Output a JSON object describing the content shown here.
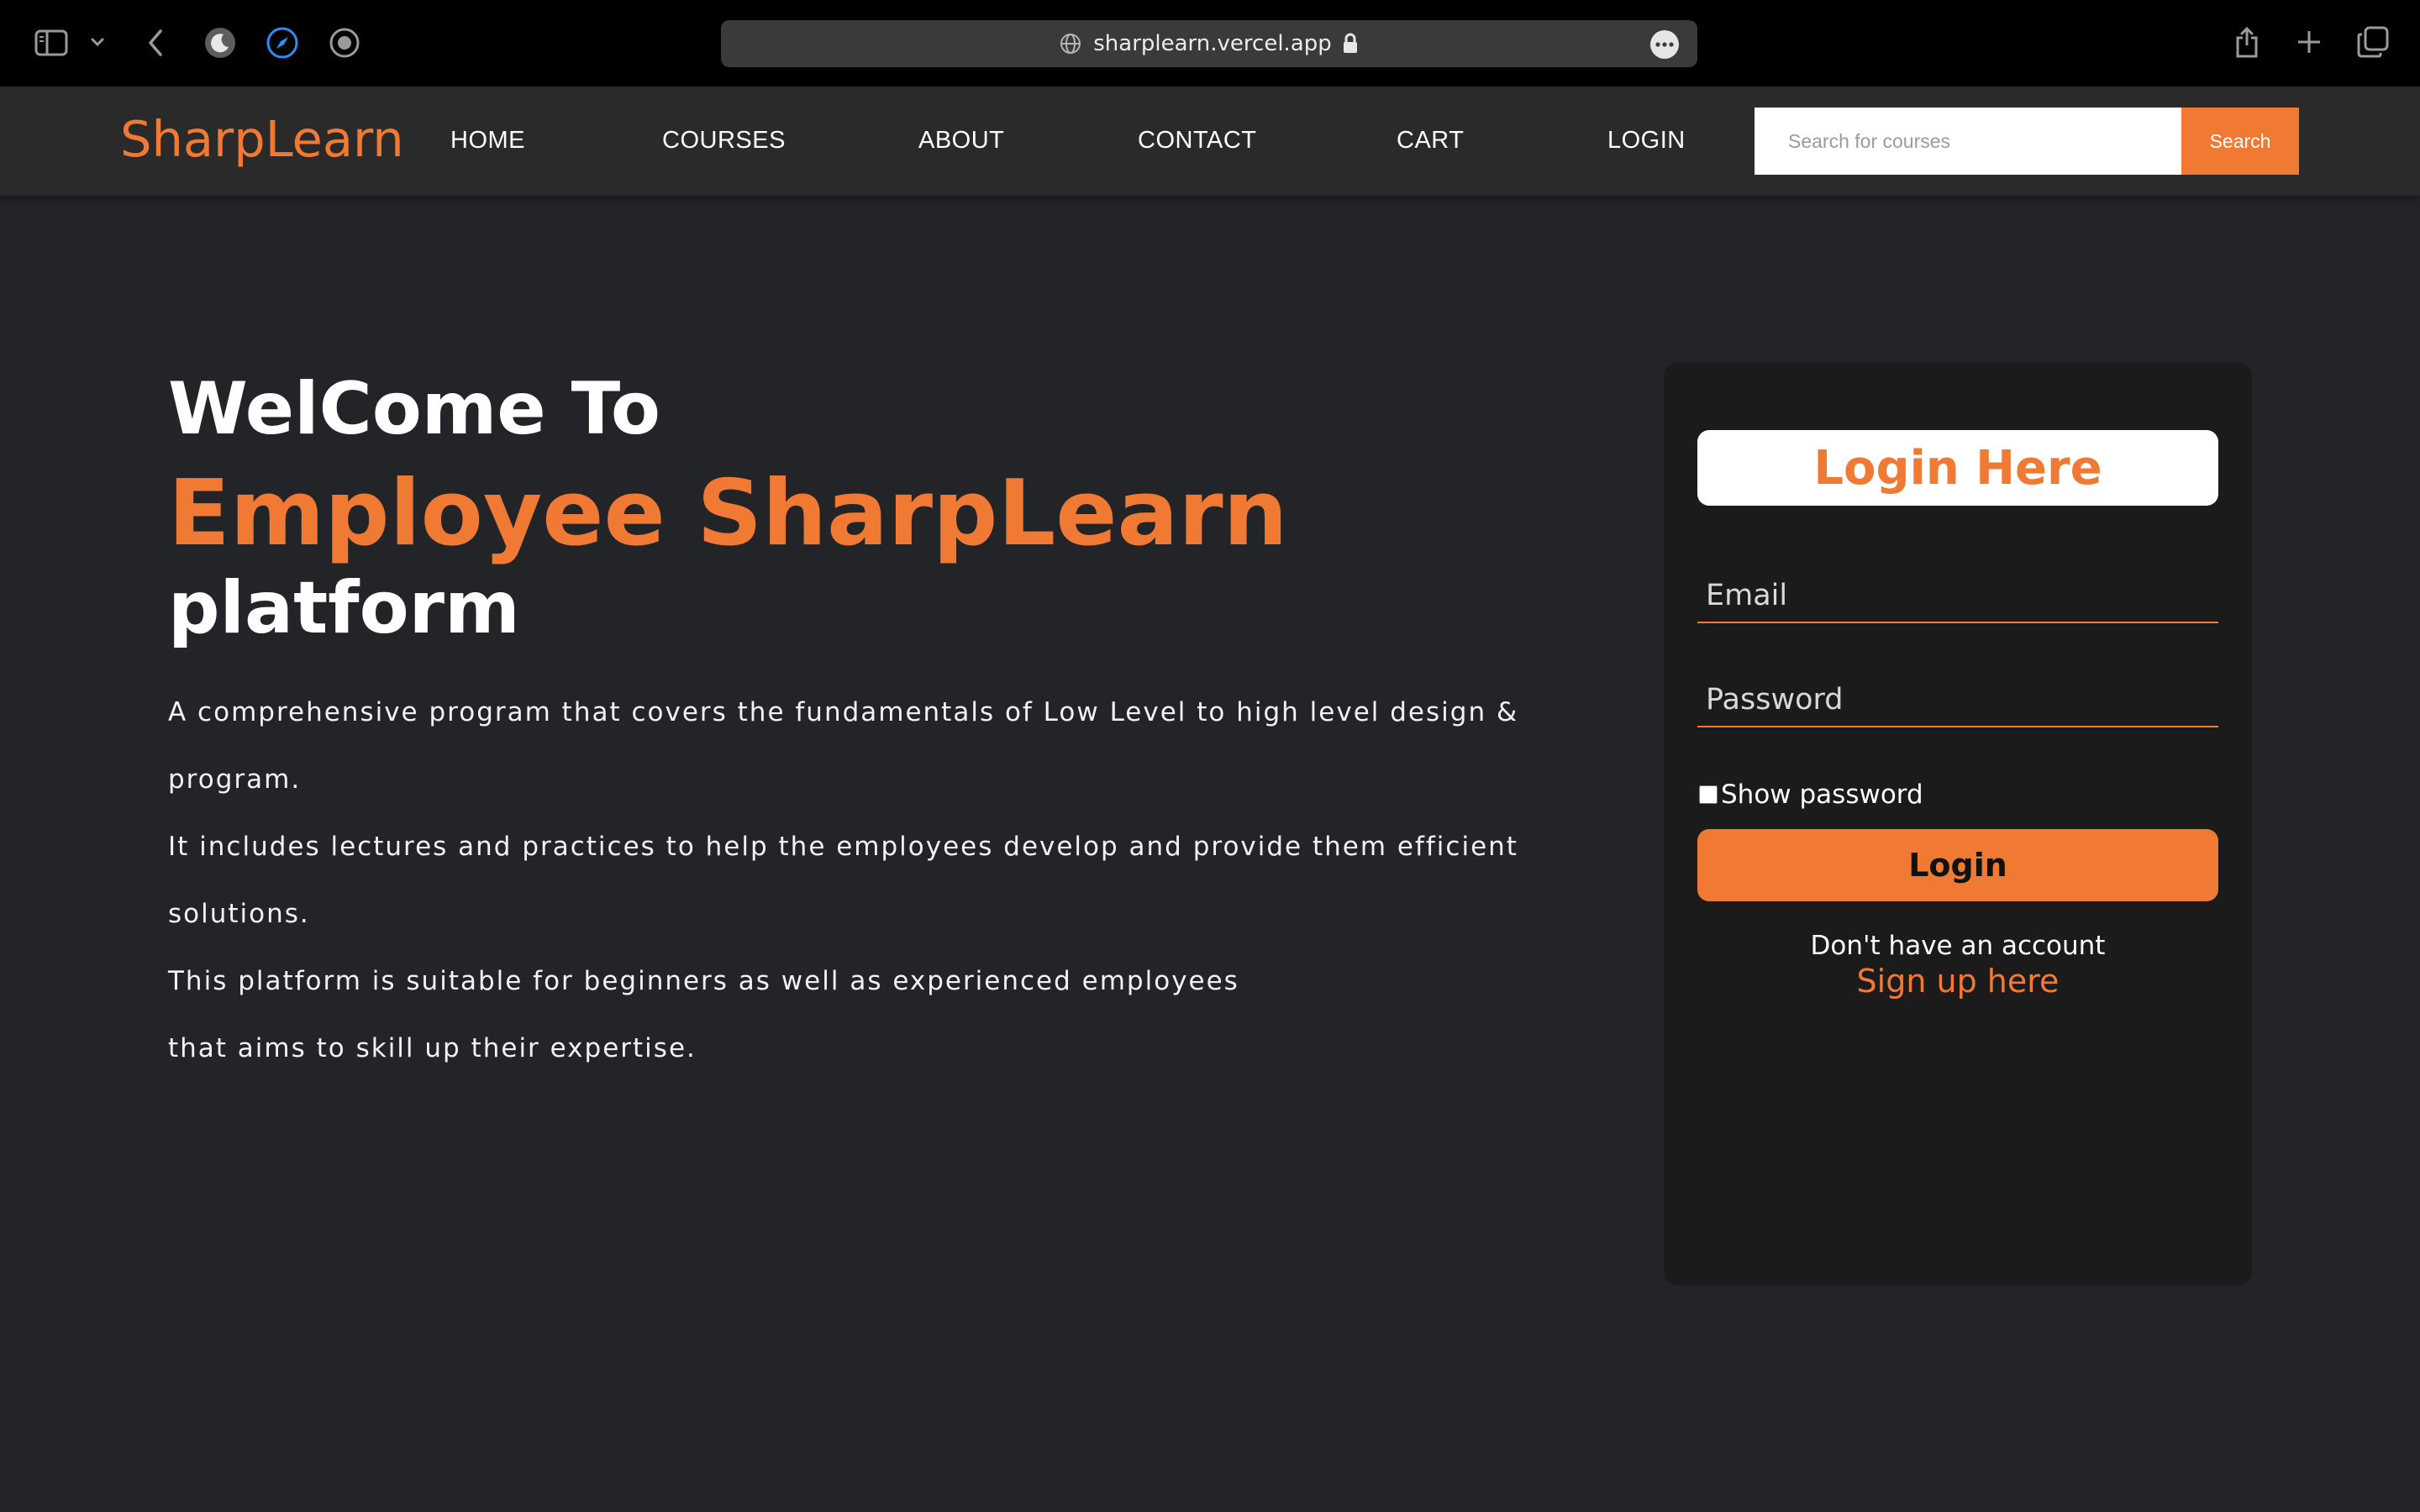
{
  "browser": {
    "url": "sharplearn.vercel.app",
    "icons": {
      "sidebar": "sidebar-icon",
      "dropdown": "chevron-down-icon",
      "back": "back-arrow-icon",
      "night_mode": "moon-icon",
      "compass": "compass-icon",
      "record": "record-icon",
      "site_globe": "globe-icon",
      "lock": "lock-icon",
      "more": "more-icon",
      "share": "share-icon",
      "new_tab": "plus-icon",
      "tabs_overview": "tabs-icon"
    }
  },
  "nav": {
    "brand": "SharpLearn",
    "links": [
      "HOME",
      "COURSES",
      "ABOUT",
      "CONTACT",
      "CART",
      "LOGIN"
    ],
    "search_placeholder": "Search for courses",
    "search_button": "Search"
  },
  "hero": {
    "line1": "WelCome To",
    "line2": "Employee SharpLearn",
    "line3": "platform",
    "paragraphs": [
      "A comprehensive program that covers the fundamentals of Low Level to high level design & program.",
      "It includes lectures and practices to help the employees develop and provide them efficient solutions.",
      "This platform is suitable for beginners as well as experienced employees",
      "that aims to skill up their expertise."
    ]
  },
  "login": {
    "title": "Login Here",
    "email_placeholder": "Email",
    "password_placeholder": "Password",
    "show_password": "Show password",
    "button": "Login",
    "no_account": "Don't have an account",
    "signup": "Sign up here"
  },
  "colors": {
    "accent": "#f07a33",
    "background": "#232427",
    "nav_background": "#2a2a2b",
    "card_background": "#1b1b1c",
    "browser_bar": "#000000"
  }
}
